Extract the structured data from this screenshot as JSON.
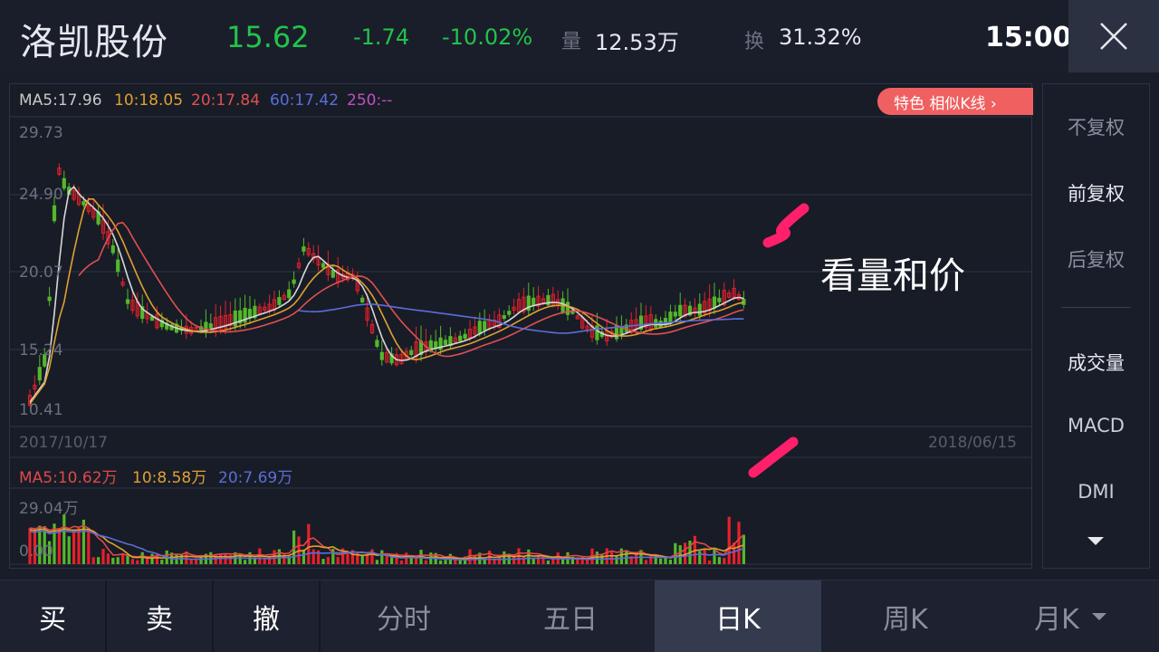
{
  "header": {
    "stock_name": "洛凯股份",
    "price": "15.62",
    "change": "-1.74",
    "change_pct": "-10.02%",
    "volume_label": "量",
    "volume_value": "12.53万",
    "turnover_label": "换",
    "turnover_value": "31.32%",
    "time": "15:00"
  },
  "chart": {
    "ma_price": {
      "ma5": "MA5:17.96",
      "ma10": "10:18.05",
      "ma20": "20:17.84",
      "ma60": "60:17.42",
      "ma250": "250:--"
    },
    "special_button": "特色  相似K线 ›",
    "y_axis": [
      "29.73",
      "24.90",
      "20.07",
      "15.24",
      "10.41"
    ],
    "date_start": "2017/10/17",
    "date_end": "2018/06/15",
    "ma_volume": {
      "ma5": "MA5:10.62万",
      "ma10": "10:8.58万",
      "ma20": "20:7.69万"
    },
    "volume_axis": [
      "29.04万",
      "0.00"
    ],
    "colors": {
      "up": "#e8202a",
      "down": "#54b82a",
      "ma5": "#d8d8d8",
      "ma10": "#e0a030",
      "ma20": "#e05050",
      "ma60": "#5a6ed8",
      "ma250": "#c050c0"
    }
  },
  "annotation": {
    "text": "看量和价"
  },
  "right_panel": {
    "items": [
      "不复权",
      "前复权",
      "后复权",
      "成交量",
      "MACD",
      "DMI"
    ],
    "more_icon": "caret-down-icon"
  },
  "bottom_bar": {
    "buy": "买",
    "sell": "卖",
    "cancel": "撤",
    "tabs": [
      "分时",
      "五日",
      "日K",
      "周K",
      "月K"
    ],
    "active_tab": "日K"
  }
}
